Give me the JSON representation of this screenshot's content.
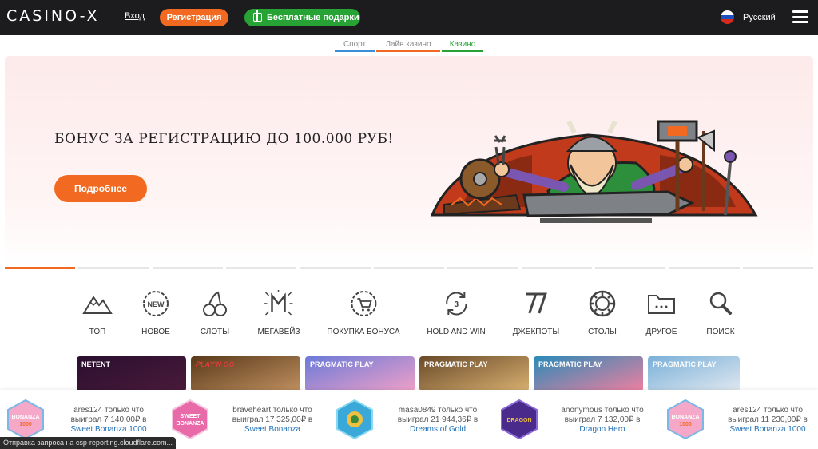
{
  "header": {
    "logo": "CASINO-X",
    "login": "Вход",
    "register": "Регистрация",
    "gifts": "Бесплатные подарки",
    "language": "Русский"
  },
  "subnav": {
    "tabs": [
      {
        "label": "Спорт",
        "color": "#3a8fd8"
      },
      {
        "label": "Лайв казино",
        "color": "#f26a21"
      },
      {
        "label": "Казино",
        "color": "#26a334"
      }
    ]
  },
  "banner": {
    "title": "БОНУС ЗА РЕГИСТРАЦИЮ ДО 100.000 РУБ!",
    "button": "Подробнее"
  },
  "categories": [
    {
      "label": "ТОП",
      "icon": "mountain-icon"
    },
    {
      "label": "НОВОЕ",
      "icon": "new-badge-icon"
    },
    {
      "label": "СЛОТЫ",
      "icon": "cherries-icon"
    },
    {
      "label": "МЕГАВЕЙЗ",
      "icon": "megaways-icon"
    },
    {
      "label": "ПОКУПКА БОНУСА",
      "icon": "cart-icon"
    },
    {
      "label": "HOLD AND WIN",
      "icon": "hold-and-win-icon"
    },
    {
      "label": "ДЖЕКПОТЫ",
      "icon": "sevens-icon"
    },
    {
      "label": "СТОЛЫ",
      "icon": "chip-icon"
    },
    {
      "label": "ДРУГОЕ",
      "icon": "folder-icon"
    },
    {
      "label": "ПОИСК",
      "icon": "search-icon"
    }
  ],
  "tiles": [
    {
      "provider": "NETENT"
    },
    {
      "provider": "PLAY'N GO"
    },
    {
      "provider": "PRAGMATIC PLAY"
    },
    {
      "provider": "PRAGMATIC PLAY"
    },
    {
      "provider": "PRAGMATIC PLAY"
    },
    {
      "provider": "PRAGMATIC PLAY"
    }
  ],
  "winners": [
    {
      "line1": "ares124 только что",
      "line2": "выиграл 7 140,00₽ в",
      "game": "Sweet Bonanza 1000",
      "thumb": "BONANZA 1000"
    },
    {
      "line1": "braveheart только что",
      "line2": "выиграл 17 325,00₽ в",
      "game": "Sweet Bonanza",
      "thumb": "SWEET BONANZA"
    },
    {
      "line1": "masa0849 только что",
      "line2": "выиграл 21 944,36₽ в",
      "game": "Dreams of Gold",
      "thumb": "DREAMS"
    },
    {
      "line1": "anonymous только что",
      "line2": "выиграл 7 132,00₽ в",
      "game": "Dragon Hero",
      "thumb": "DRAGON"
    },
    {
      "line1": "ares124 только что",
      "line2": "выиграл 11 230,00₽ в",
      "game": "Sweet Bonanza 1000",
      "thumb": "BONANZA 1000"
    }
  ],
  "status_text": "Отправка запроса на csp-reporting.cloudflare.com..."
}
